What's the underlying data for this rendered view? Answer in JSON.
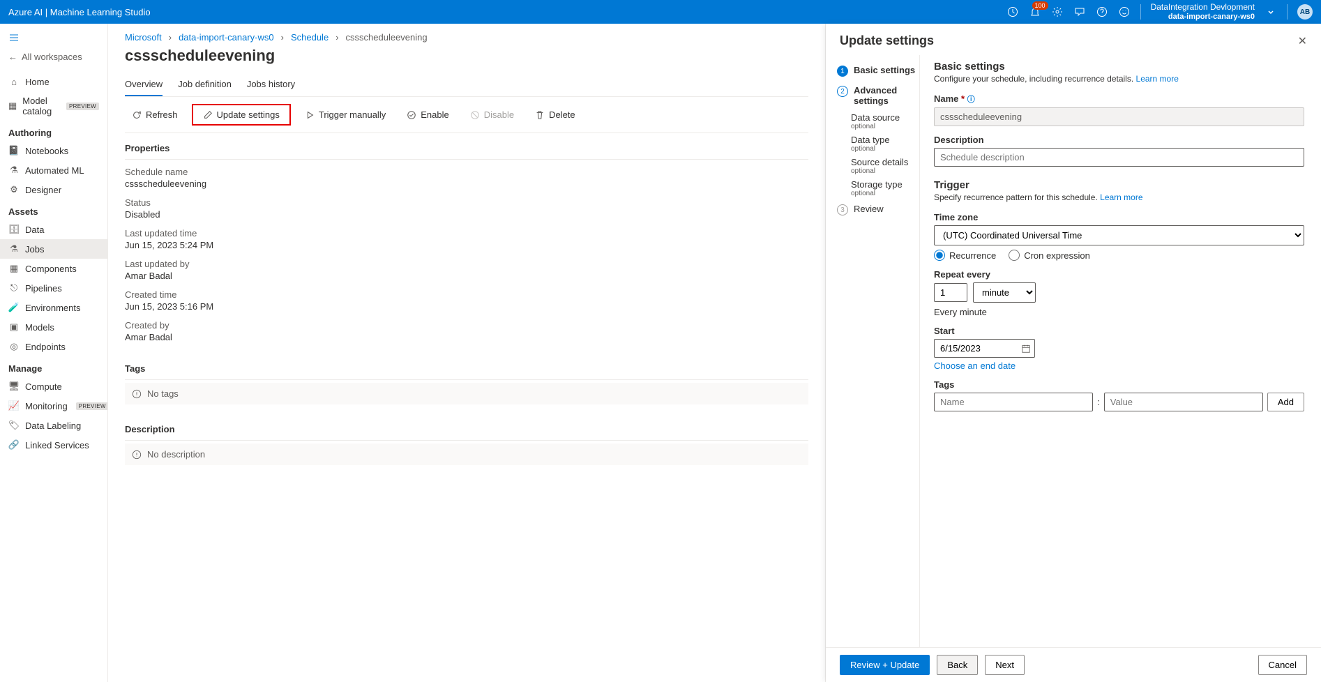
{
  "header": {
    "product": "Azure AI | Machine Learning Studio",
    "badge_count": "100",
    "tenant_name": "DataIntegration Devlopment",
    "workspace_name": "data-import-canary-ws0",
    "avatar_initials": "AB"
  },
  "sidebar": {
    "back": "All workspaces",
    "items_top": [
      {
        "label": "Home"
      },
      {
        "label": "Model catalog",
        "preview": true
      }
    ],
    "groups": [
      {
        "heading": "Authoring",
        "items": [
          {
            "label": "Notebooks"
          },
          {
            "label": "Automated ML"
          },
          {
            "label": "Designer"
          }
        ]
      },
      {
        "heading": "Assets",
        "items": [
          {
            "label": "Data"
          },
          {
            "label": "Jobs",
            "active": true
          },
          {
            "label": "Components"
          },
          {
            "label": "Pipelines"
          },
          {
            "label": "Environments"
          },
          {
            "label": "Models"
          },
          {
            "label": "Endpoints"
          }
        ]
      },
      {
        "heading": "Manage",
        "items": [
          {
            "label": "Compute"
          },
          {
            "label": "Monitoring",
            "preview": true
          },
          {
            "label": "Data Labeling"
          },
          {
            "label": "Linked Services"
          }
        ]
      }
    ]
  },
  "breadcrumb": [
    "Microsoft",
    "data-import-canary-ws0",
    "Schedule",
    "cssscheduleevening"
  ],
  "page_title": "cssscheduleevening",
  "tabs": [
    "Overview",
    "Job definition",
    "Jobs history"
  ],
  "toolbar": {
    "refresh": "Refresh",
    "update": "Update settings",
    "trigger": "Trigger manually",
    "enable": "Enable",
    "disable": "Disable",
    "delete": "Delete"
  },
  "details": {
    "section_props": "Properties",
    "rows": [
      {
        "label": "Schedule name",
        "value": "cssscheduleevening"
      },
      {
        "label": "Status",
        "value": "Disabled"
      },
      {
        "label": "Last updated time",
        "value": "Jun 15, 2023 5:24 PM"
      },
      {
        "label": "Last updated by",
        "value": "Amar Badal"
      },
      {
        "label": "Created time",
        "value": "Jun 15, 2023 5:16 PM"
      },
      {
        "label": "Created by",
        "value": "Amar Badal"
      }
    ],
    "section_tags": "Tags",
    "no_tags": "No tags",
    "section_desc": "Description",
    "no_desc": "No description"
  },
  "panel": {
    "title": "Update settings",
    "steps": {
      "s1": "Basic settings",
      "s2": "Advanced settings",
      "subs": [
        {
          "label": "Data source",
          "opt": "optional"
        },
        {
          "label": "Data type",
          "opt": "optional"
        },
        {
          "label": "Source details",
          "opt": "optional"
        },
        {
          "label": "Storage type",
          "opt": "optional"
        }
      ],
      "s3": "Review"
    },
    "form": {
      "heading": "Basic settings",
      "desc": "Configure your schedule, including recurrence details.",
      "learn_more": "Learn more",
      "name_label": "Name",
      "name_value": "cssscheduleevening",
      "desc_label": "Description",
      "desc_placeholder": "Schedule description",
      "trigger_heading": "Trigger",
      "trigger_desc": "Specify recurrence pattern for this schedule.",
      "tz_label": "Time zone",
      "tz_value": "(UTC) Coordinated Universal Time",
      "radio_recurrence": "Recurrence",
      "radio_cron": "Cron expression",
      "repeat_label": "Repeat every",
      "repeat_value": "1",
      "repeat_unit": "minute",
      "repeat_summary": "Every minute",
      "start_label": "Start",
      "start_value": "6/15/2023",
      "choose_end": "Choose an end date",
      "tags_label": "Tags",
      "tag_name_ph": "Name",
      "tag_value_ph": "Value",
      "add": "Add"
    },
    "footer": {
      "review": "Review + Update",
      "back": "Back",
      "next": "Next",
      "cancel": "Cancel"
    }
  }
}
